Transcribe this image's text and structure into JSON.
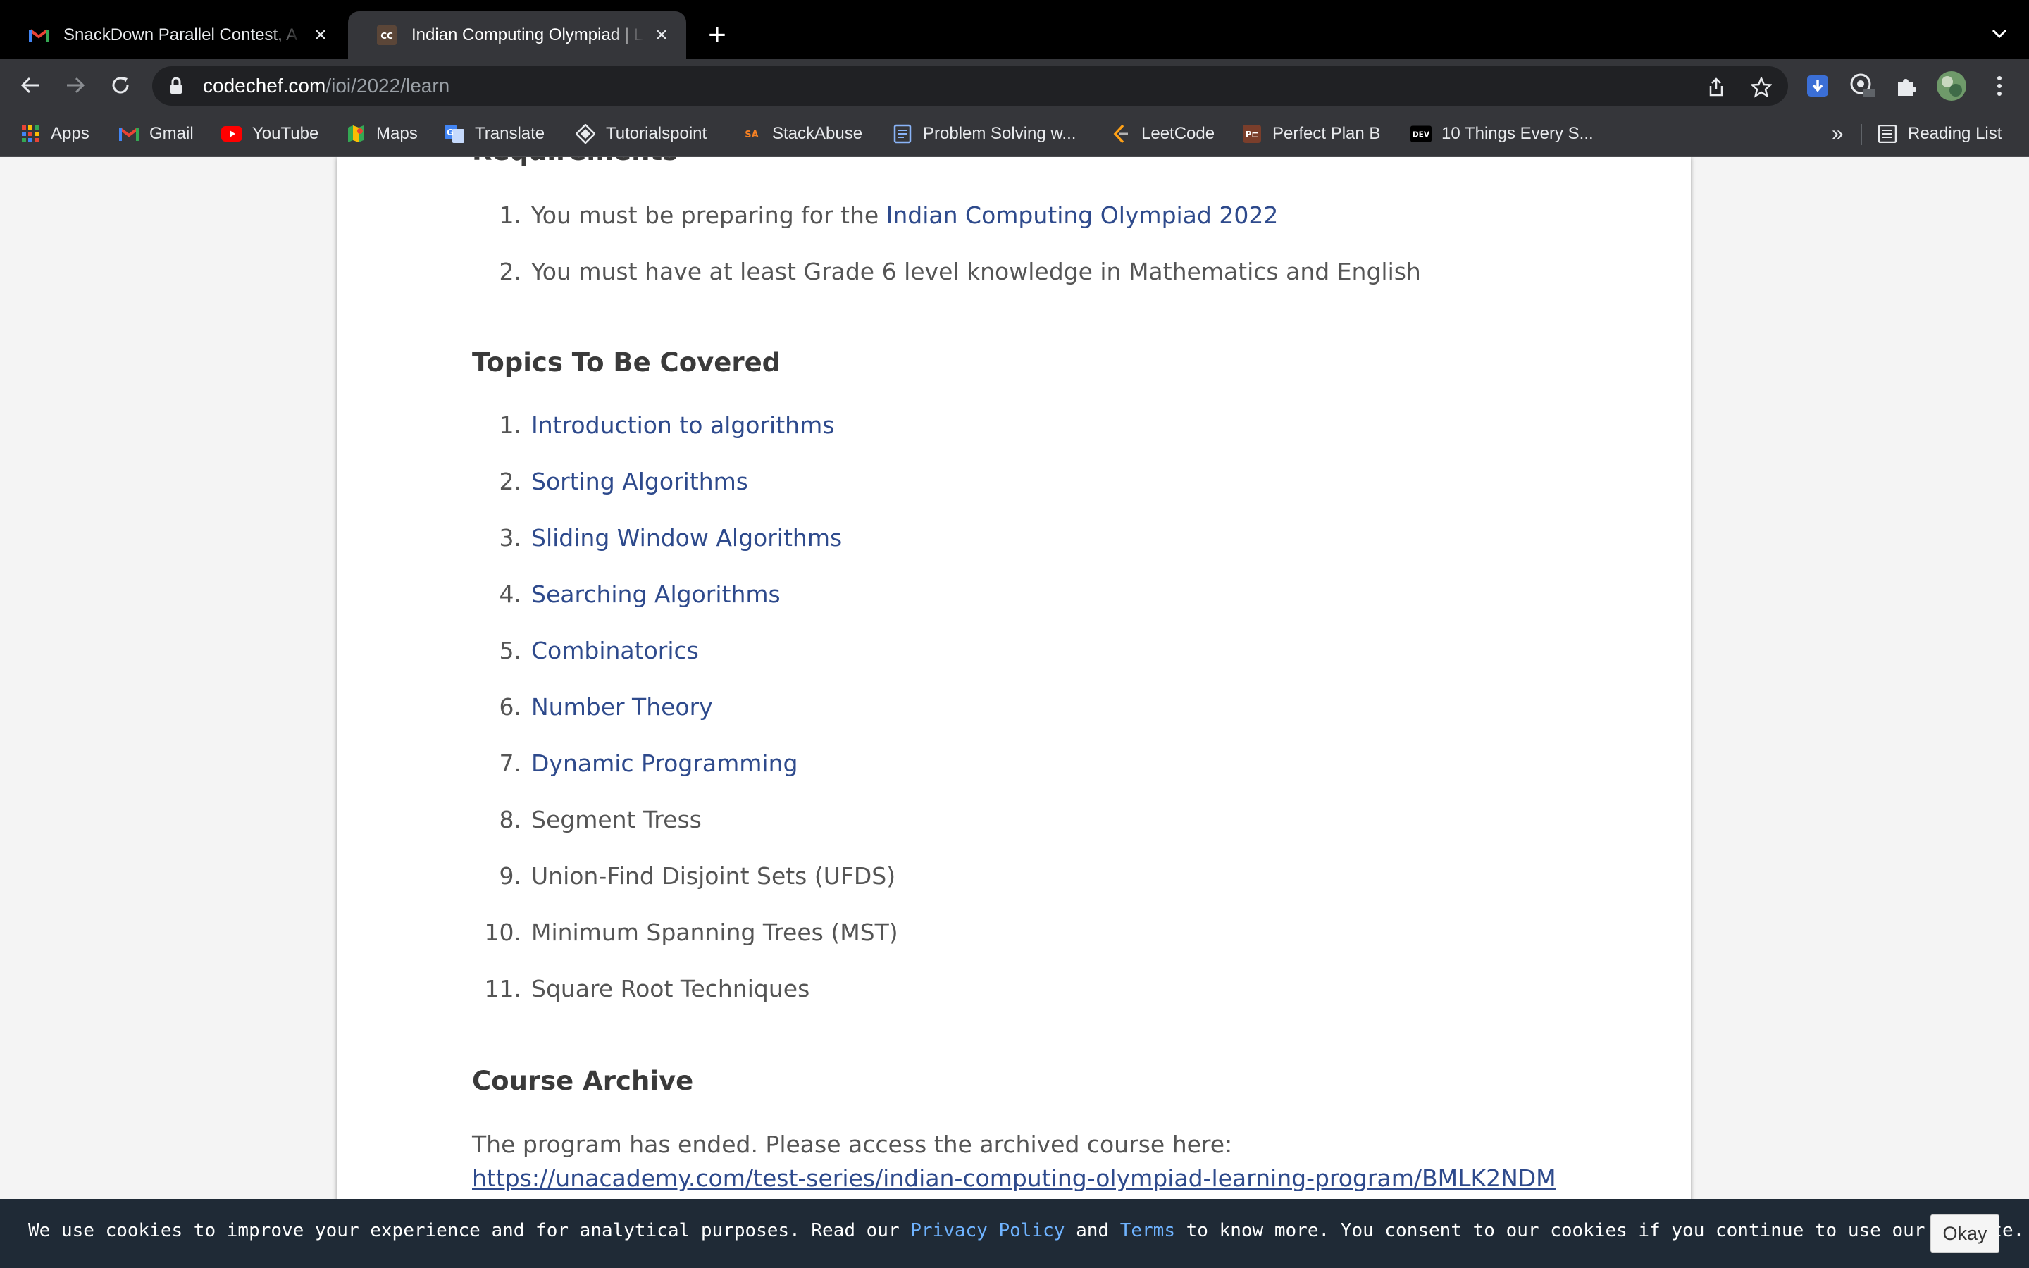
{
  "browser": {
    "tabs": [
      {
        "title": "SnackDown Parallel Contest, A",
        "icon": "gmail-icon",
        "active": false
      },
      {
        "title": "Indian Computing Olympiad | L",
        "icon": "codechef-icon",
        "active": true
      }
    ],
    "url_host": "codechef.com",
    "url_path": "/ioi/2022/learn",
    "bookmarks": [
      {
        "label": "Apps",
        "icon": "apps-grid-icon"
      },
      {
        "label": "Gmail",
        "icon": "gmail-icon"
      },
      {
        "label": "YouTube",
        "icon": "youtube-icon"
      },
      {
        "label": "Maps",
        "icon": "maps-icon"
      },
      {
        "label": "Translate",
        "icon": "translate-icon"
      },
      {
        "label": "Tutorialspoint",
        "icon": "tutorialspoint-icon"
      },
      {
        "label": "StackAbuse",
        "icon": "stackabuse-icon"
      },
      {
        "label": "Problem Solving w...",
        "icon": "book-icon"
      },
      {
        "label": "LeetCode",
        "icon": "leetcode-icon"
      },
      {
        "label": "Perfect Plan B",
        "icon": "perfectplanb-icon"
      },
      {
        "label": "10 Things Every S...",
        "icon": "dev-icon"
      }
    ],
    "overflow_label": "»",
    "reading_list": "Reading List"
  },
  "requirements": {
    "heading": "Requirements",
    "items": [
      {
        "num": "1.",
        "prefix": "You must be preparing for the ",
        "link": "Indian Computing Olympiad 2022"
      },
      {
        "num": "2.",
        "prefix": "You must have at least Grade 6 level knowledge in Mathematics and English",
        "link": ""
      }
    ]
  },
  "topics": {
    "heading": "Topics To Be Covered",
    "items": [
      {
        "num": "1.",
        "text": "Introduction to algorithms",
        "link": true
      },
      {
        "num": "2.",
        "text": "Sorting Algorithms",
        "link": true
      },
      {
        "num": "3.",
        "text": "Sliding Window Algorithms",
        "link": true
      },
      {
        "num": "4.",
        "text": "Searching Algorithms",
        "link": true
      },
      {
        "num": "5.",
        "text": "Combinatorics",
        "link": true
      },
      {
        "num": "6.",
        "text": "Number Theory",
        "link": true
      },
      {
        "num": "7.",
        "text": "Dynamic Programming",
        "link": true
      },
      {
        "num": "8.",
        "text": "Segment Tress",
        "link": false
      },
      {
        "num": "9.",
        "text": "Union-Find Disjoint Sets (UFDS)",
        "link": false
      },
      {
        "num": "10.",
        "text": "Minimum Spanning Trees (MST)",
        "link": false
      },
      {
        "num": "11.",
        "text": "Square Root Techniques",
        "link": false
      }
    ]
  },
  "archive": {
    "heading": "Course Archive",
    "text": "The program has ended. Please access the archived course here: ",
    "link": "https://unacademy.com/test-series/indian-computing-olympiad-learning-program/BMLK2NDM"
  },
  "cookie": {
    "text1": "We use cookies to improve your experience and for analytical purposes. Read our ",
    "privacy": "Privacy Policy",
    "text2": " and ",
    "terms": "Terms",
    "text3": " to know more. You consent to our cookies if you continue to use our website.",
    "button": "Okay"
  },
  "colors": {
    "link": "#2e4a8c",
    "cookie_bg": "#1f2a36",
    "cookie_link": "#6fb3ff"
  }
}
